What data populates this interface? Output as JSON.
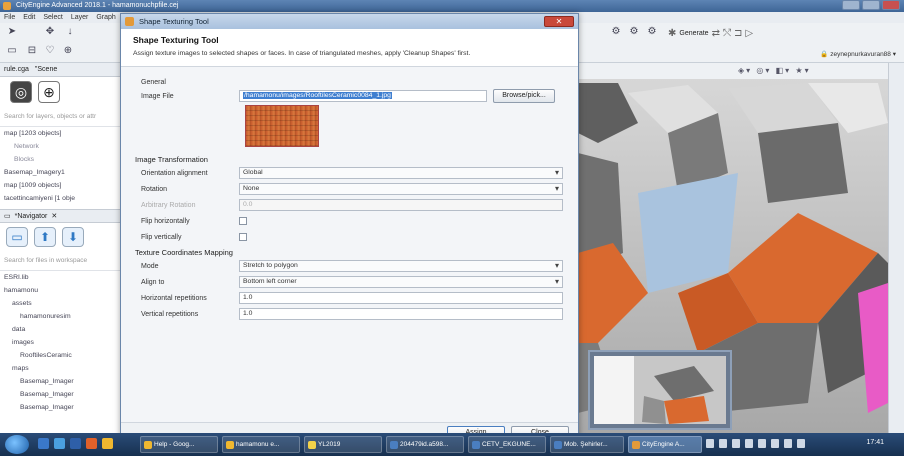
{
  "app": {
    "title": "CityEngine Advanced 2018.1 - hamamonuchpfile.cej",
    "menu": [
      "File",
      "Edit",
      "Select",
      "Layer",
      "Graph"
    ]
  },
  "toolbar": {
    "generate_label": "Generate",
    "user": "zeynepnurkavuran88"
  },
  "left_panel": {
    "tabs": [
      "rule.cga",
      "\"Scene"
    ],
    "search_placeholder": "Search for layers, objects or attr",
    "layers": [
      "map [1203 objects]",
      "Network",
      "Blocks",
      "Basemap_Imagery1",
      "map [1009 objects]",
      "tacettincamiyeni [1 obje"
    ]
  },
  "navigator": {
    "tab": "*Navigator",
    "search_placeholder": "Search for files in workspace",
    "items": [
      "ESRI.lib",
      "hamamonu",
      "assets",
      "hamamonuresim",
      "data",
      "images",
      "RooftilesCeramic",
      "maps",
      "Basemap_Imager",
      "Basemap_Imager",
      "Basemap_Imager"
    ]
  },
  "dialog": {
    "window_title": "Shape Texturing Tool",
    "header_title": "Shape Texturing Tool",
    "header_desc": "Assign texture images to selected shapes or faces. In case of triangulated meshes, apply 'Cleanup Shapes' first.",
    "general_label": "General",
    "image_file_label": "Image File",
    "image_file_value": "/hamamonu/images/RooftilesCeramic0084_1.jpg",
    "browse_label": "Browse/pick...",
    "transform_label": "Image Transformation",
    "orientation_label": "Orientation alignment",
    "orientation_value": "Global",
    "rotation_label": "Rotation",
    "rotation_value": "None",
    "arb_rotation_label": "Arbitrary Rotation",
    "arb_rotation_value": "0.0",
    "flip_h_label": "Flip horizontally",
    "flip_v_label": "Flip vertically",
    "mapping_label": "Texture Coordinates Mapping",
    "mode_label": "Mode",
    "mode_value": "Stretch to polygon",
    "align_label": "Align to",
    "align_value": "Bottom left corner",
    "h_rep_label": "Horizontal repetitions",
    "h_rep_value": "1.0",
    "v_rep_label": "Vertical repetitions",
    "v_rep_value": "1.0",
    "assign_label": "Assign",
    "close_label": "Close"
  },
  "taskbar": {
    "tasks": [
      "Help - Goog...",
      "hamamonu e...",
      "YL2019",
      "204479id.a598...",
      "CETV_EKGUNE...",
      "Mob. Şehirler...",
      "CityEngine A..."
    ],
    "clock": "17:41"
  },
  "colors": {
    "roof_orange": "#d9692f",
    "building_gray": "#6e6e6e",
    "pink": "#e85bc6",
    "accent_blue": "#3f7fd0"
  }
}
